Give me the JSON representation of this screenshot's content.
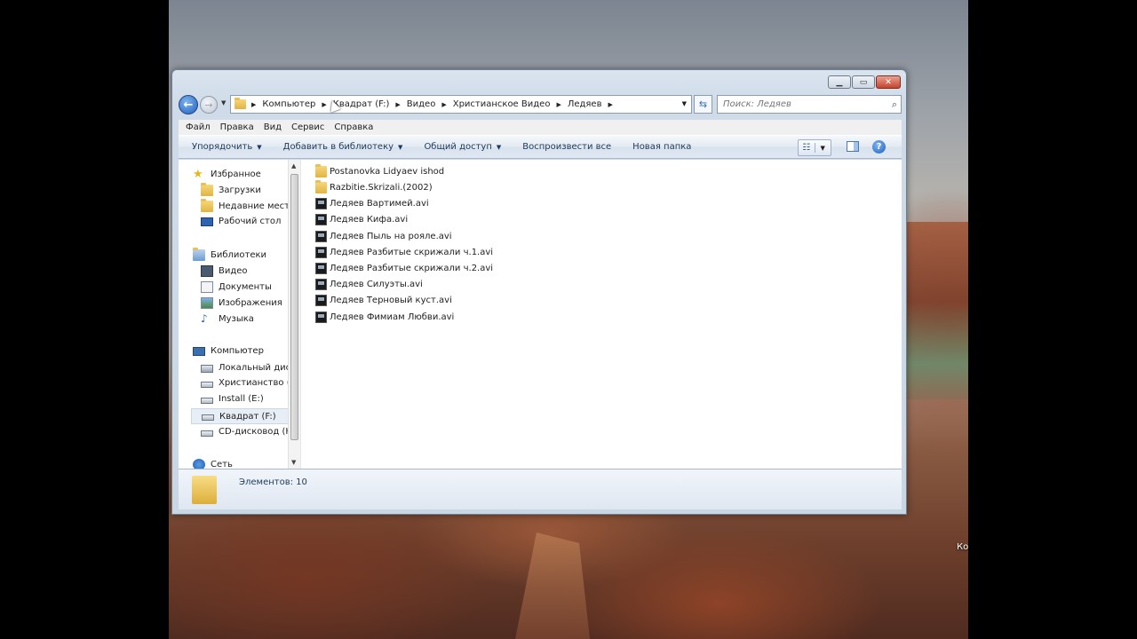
{
  "desktop": {
    "icon_label": "Ко"
  },
  "window": {
    "caption_buttons": {
      "minimize": "▁",
      "maximize": "▭",
      "close": "✕"
    },
    "nav": {
      "back_icon": "arrow-left-icon",
      "forward_icon": "arrow-right-icon",
      "breadcrumbs": [
        "Компьютер",
        "Квадрат (F:)",
        "Видео",
        "Христианское Видео",
        "Ледяев"
      ],
      "search_placeholder": "Поиск: Ледяев"
    },
    "menu": [
      "Файл",
      "Правка",
      "Вид",
      "Сервис",
      "Справка"
    ],
    "commands": [
      "Упорядочить",
      "Добавить в библиотеку",
      "Общий доступ",
      "Воспроизвести все",
      "Новая папка"
    ],
    "sidebar": {
      "favorites": {
        "label": "Избранное",
        "items": [
          "Загрузки",
          "Недавние места",
          "Рабочий стол"
        ]
      },
      "libraries": {
        "label": "Библиотеки",
        "items": [
          "Видео",
          "Документы",
          "Изображения",
          "Музыка"
        ]
      },
      "computer": {
        "label": "Компьютер",
        "items": [
          "Локальный диск",
          "Христианство (D",
          "Install (E:)",
          "Квадрат (F:)",
          "CD-дисковод (H"
        ]
      },
      "network": {
        "label": "Сеть"
      },
      "selected": "Квадрат (F:)"
    },
    "files": [
      {
        "name": "Postanovka Lidyaev ishod",
        "type": "folder"
      },
      {
        "name": "Razbitie.Skrizali.(2002)",
        "type": "folder"
      },
      {
        "name": "Ледяев  Вартимей.avi",
        "type": "video"
      },
      {
        "name": "Ледяев  Кифа.avi",
        "type": "video"
      },
      {
        "name": "Ледяев  Пыль на рояле.avi",
        "type": "video"
      },
      {
        "name": "Ледяев  Разбитые скрижали ч.1.avi",
        "type": "video"
      },
      {
        "name": "Ледяев  Разбитые скрижали ч.2.avi",
        "type": "video"
      },
      {
        "name": "Ледяев  Силуэты.avi",
        "type": "video"
      },
      {
        "name": "Ледяев  Терновый куст.avi",
        "type": "video"
      },
      {
        "name": "Ледяев  Фимиам Любви.avi",
        "type": "video"
      }
    ],
    "status": "Элементов: 10"
  }
}
